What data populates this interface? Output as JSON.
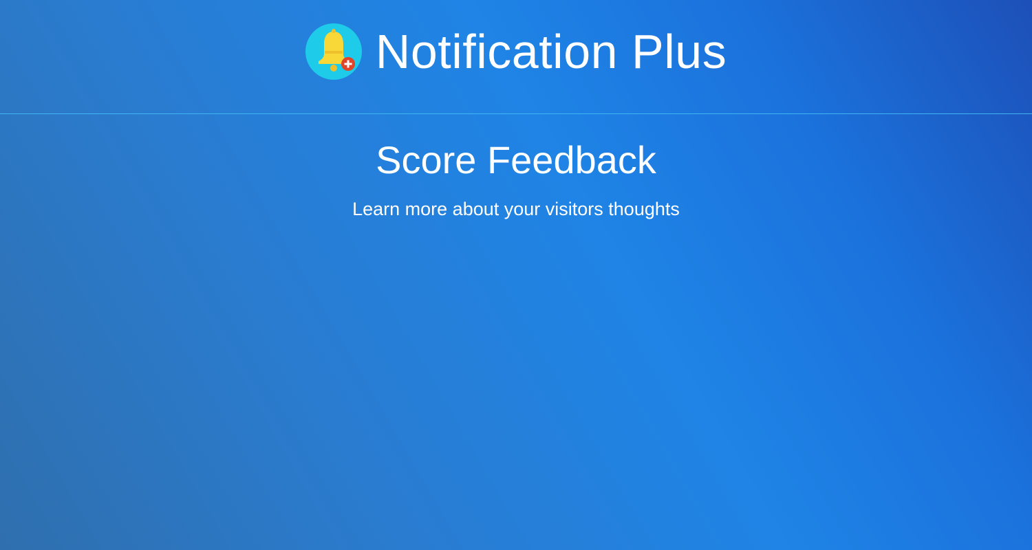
{
  "header": {
    "logo_icon": "bell-plus-icon",
    "app_name": "Notification Plus"
  },
  "hero": {
    "title": "Score Feedback",
    "subtitle": "Learn more about your visitors thoughts"
  },
  "colors": {
    "background_start": "#2f6fae",
    "background_mid": "#1f84e6",
    "background_end": "#1d50b8",
    "divider": "#3fb6f2",
    "logo_circle": "#1ecbe8",
    "bell": "#f8d838",
    "badge": "#e0442a",
    "text": "#ffffff"
  }
}
